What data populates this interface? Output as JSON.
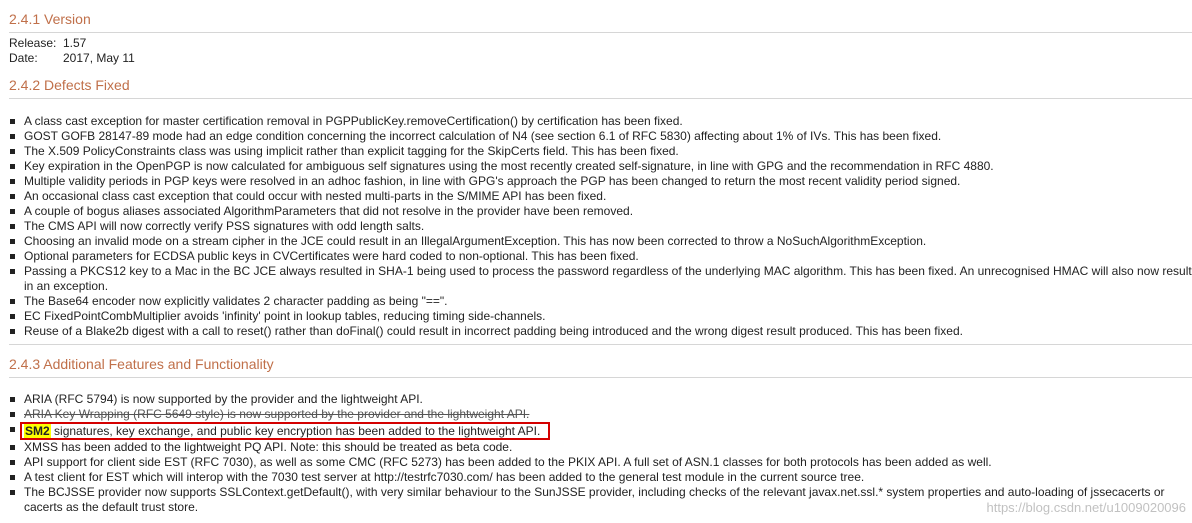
{
  "version_section": {
    "heading": "2.4.1 Version",
    "release_label": "Release:",
    "release_value": "1.57",
    "date_label": "Date:",
    "date_value": "2017, May 11"
  },
  "defects_section": {
    "heading": "2.4.2 Defects Fixed",
    "items": [
      "A class cast exception for master certification removal in PGPPublicKey.removeCertification() by certification has been fixed.",
      "GOST GOFB 28147-89 mode had an edge condition concerning the incorrect calculation of N4 (see section 6.1 of RFC 5830) affecting about 1% of IVs. This has been fixed.",
      "The X.509 PolicyConstraints class was using implicit rather than explicit tagging for the SkipCerts field. This has been fixed.",
      "Key expiration in the OpenPGP is now calculated for ambiguous self signatures using the most recently created self-signature, in line with GPG and the recommendation in RFC 4880.",
      "Multiple validity periods in PGP keys were resolved in an adhoc fashion, in line with GPG's approach the PGP has been changed to return the most recent validity period signed.",
      "An occasional class cast exception that could occur with nested multi-parts in the S/MIME API has been fixed.",
      "A couple of bogus aliases associated AlgorithmParameters that did not resolve in the provider have been removed.",
      "The CMS API will now correctly verify PSS signatures with odd length salts.",
      "Choosing an invalid mode on a stream cipher in the JCE could result in an IllegalArgumentException. This has now been corrected to throw a NoSuchAlgorithmException.",
      "Optional parameters for ECDSA public keys in CVCertificates were hard coded to non-optional. This has been fixed.",
      "Passing a PKCS12 key to a Mac in the BC JCE always resulted in SHA-1 being used to process the password regardless of the underlying MAC algorithm. This has been fixed. An unrecognised HMAC will also now result in an exception.",
      "The Base64 encoder now explicitly validates 2 character padding as being \"==\".",
      "EC FixedPointCombMultiplier avoids 'infinity' point in lookup tables, reducing timing side-channels.",
      "Reuse of a Blake2b digest with a call to reset() rather than doFinal() could result in incorrect padding being introduced and the wrong digest result produced. This has been fixed."
    ]
  },
  "features_section": {
    "heading": "2.4.3 Additional Features and Functionality",
    "item_aria": "ARIA (RFC 5794) is now supported by the provider and the lightweight API.",
    "item_aria_keywrap": "ARIA Key Wrapping (RFC 5649 style) is now supported by the provider and the lightweight API.",
    "item_sm2_highlight": "SM2",
    "item_sm2_rest": " signatures, key exchange, and public key encryption has been added to the lightweight API.",
    "item_xmss": "XMSS has been added to the lightweight PQ API. Note: this should be treated as beta code.",
    "item_est": "API support for client side EST (RFC 7030), as well as some CMC (RFC 5273) has been added to the PKIX API. A full set of ASN.1 classes for both protocols has been added as well.",
    "item_test_client": "A test client for EST which will interop with the 7030 test server at http://testrfc7030.com/ has been added to the general test module in the current source tree.",
    "item_bcjsse": "The BCJSSE provider now supports SSLContext.getDefault(), with very similar behaviour to the SunJSSE provider, including checks of the relevant javax.net.ssl.* system properties and auto-loading of jssecacerts or cacerts as the default trust store."
  },
  "watermark": "https://blog.csdn.net/u1009020096"
}
